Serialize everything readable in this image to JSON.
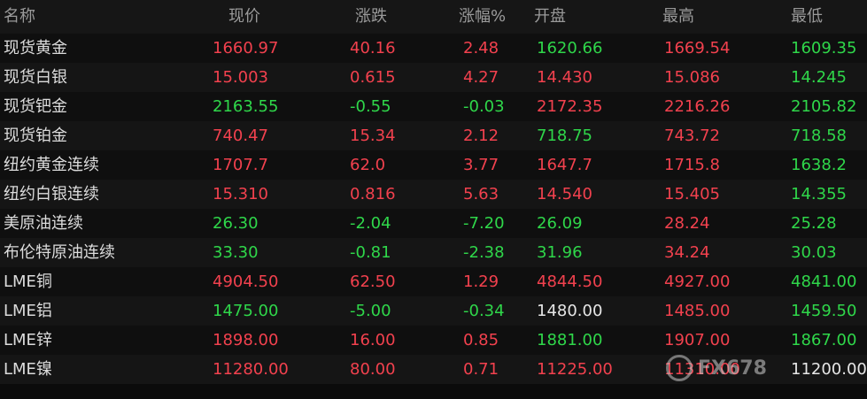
{
  "colors": {
    "up": "#f2414e",
    "down": "#2fd74a",
    "flat": "#e6e6e6",
    "background": "#0b0b0b"
  },
  "header": {
    "name": "名称",
    "price": "现价",
    "change": "涨跌",
    "pct": "涨幅%",
    "open": "开盘",
    "high": "最高",
    "low": "最低"
  },
  "rows": [
    {
      "name": "现货黄金",
      "price": "1660.97",
      "price_dir": "up",
      "change": "40.16",
      "change_dir": "up",
      "pct": "2.48",
      "pct_dir": "up",
      "open": "1620.66",
      "open_dir": "down",
      "high": "1669.54",
      "high_dir": "up",
      "low": "1609.35",
      "low_dir": "down"
    },
    {
      "name": "现货白银",
      "price": "15.003",
      "price_dir": "up",
      "change": "0.615",
      "change_dir": "up",
      "pct": "4.27",
      "pct_dir": "up",
      "open": "14.430",
      "open_dir": "up",
      "high": "15.086",
      "high_dir": "up",
      "low": "14.245",
      "low_dir": "down"
    },
    {
      "name": "现货钯金",
      "price": "2163.55",
      "price_dir": "down",
      "change": "-0.55",
      "change_dir": "down",
      "pct": "-0.03",
      "pct_dir": "down",
      "open": "2172.35",
      "open_dir": "up",
      "high": "2216.26",
      "high_dir": "up",
      "low": "2105.82",
      "low_dir": "down"
    },
    {
      "name": "现货铂金",
      "price": "740.47",
      "price_dir": "up",
      "change": "15.34",
      "change_dir": "up",
      "pct": "2.12",
      "pct_dir": "up",
      "open": "718.75",
      "open_dir": "down",
      "high": "743.72",
      "high_dir": "up",
      "low": "718.58",
      "low_dir": "down"
    },
    {
      "name": "纽约黄金连续",
      "price": "1707.7",
      "price_dir": "up",
      "change": "62.0",
      "change_dir": "up",
      "pct": "3.77",
      "pct_dir": "up",
      "open": "1647.7",
      "open_dir": "up",
      "high": "1715.8",
      "high_dir": "up",
      "low": "1638.2",
      "low_dir": "down"
    },
    {
      "name": "纽约白银连续",
      "price": "15.310",
      "price_dir": "up",
      "change": "0.816",
      "change_dir": "up",
      "pct": "5.63",
      "pct_dir": "up",
      "open": "14.540",
      "open_dir": "up",
      "high": "15.405",
      "high_dir": "up",
      "low": "14.355",
      "low_dir": "down"
    },
    {
      "name": "美原油连续",
      "price": "26.30",
      "price_dir": "down",
      "change": "-2.04",
      "change_dir": "down",
      "pct": "-7.20",
      "pct_dir": "down",
      "open": "26.09",
      "open_dir": "down",
      "high": "28.24",
      "high_dir": "up",
      "low": "25.28",
      "low_dir": "down"
    },
    {
      "name": "布伦特原油连续",
      "price": "33.30",
      "price_dir": "down",
      "change": "-0.81",
      "change_dir": "down",
      "pct": "-2.38",
      "pct_dir": "down",
      "open": "31.96",
      "open_dir": "down",
      "high": "34.24",
      "high_dir": "up",
      "low": "30.03",
      "low_dir": "down"
    },
    {
      "name": "LME铜",
      "price": "4904.50",
      "price_dir": "up",
      "change": "62.50",
      "change_dir": "up",
      "pct": "1.29",
      "pct_dir": "up",
      "open": "4844.50",
      "open_dir": "up",
      "high": "4927.00",
      "high_dir": "up",
      "low": "4841.00",
      "low_dir": "down"
    },
    {
      "name": "LME铝",
      "price": "1475.00",
      "price_dir": "down",
      "change": "-5.00",
      "change_dir": "down",
      "pct": "-0.34",
      "pct_dir": "down",
      "open": "1480.00",
      "open_dir": "flat",
      "high": "1485.00",
      "high_dir": "up",
      "low": "1459.50",
      "low_dir": "down"
    },
    {
      "name": "LME锌",
      "price": "1898.00",
      "price_dir": "up",
      "change": "16.00",
      "change_dir": "up",
      "pct": "0.85",
      "pct_dir": "up",
      "open": "1881.00",
      "open_dir": "down",
      "high": "1907.00",
      "high_dir": "up",
      "low": "1867.00",
      "low_dir": "down"
    },
    {
      "name": "LME镍",
      "price": "11280.00",
      "price_dir": "up",
      "change": "80.00",
      "change_dir": "up",
      "pct": "0.71",
      "pct_dir": "up",
      "open": "11225.00",
      "open_dir": "up",
      "high": "11310.00",
      "high_dir": "up",
      "low": "11200.00",
      "low_dir": "flat"
    }
  ],
  "watermark": {
    "text": "FX678",
    "icon": "fx678-logo-icon"
  }
}
